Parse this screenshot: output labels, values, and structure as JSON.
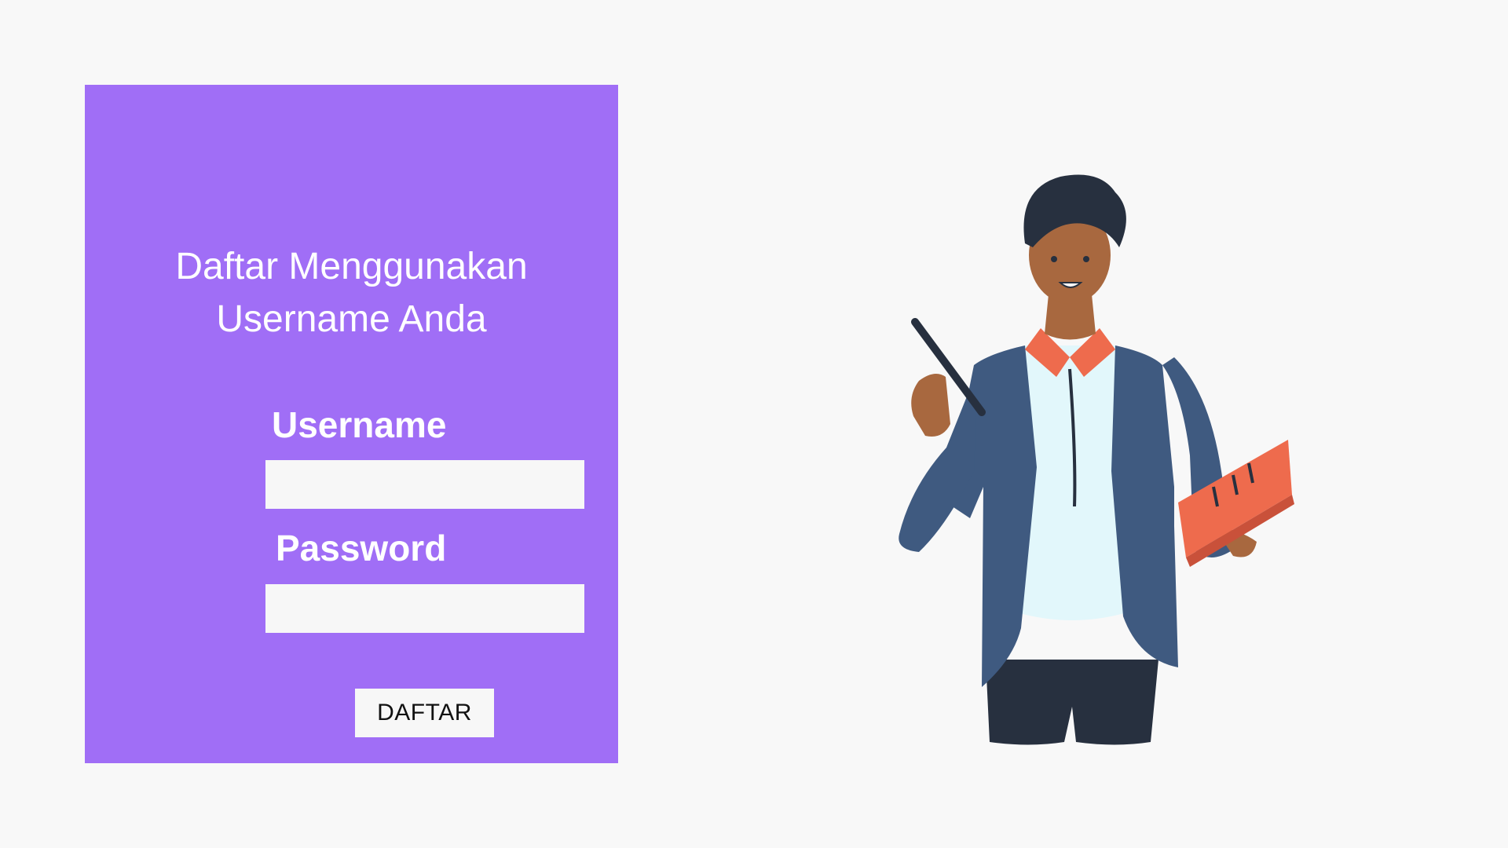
{
  "form": {
    "title_line1": "Daftar Menggunakan",
    "title_line2": "Username Anda",
    "username_label": "Username",
    "username_value": "",
    "password_label": "Password",
    "password_value": "",
    "submit_label": "DAFTAR"
  },
  "illustration": {
    "icon": "person-holding-pen-and-book-icon"
  },
  "colors": {
    "background": "#f8f8f8",
    "card": "#a06ef6",
    "input": "#f7f7f7",
    "jacket": "#3f5a80",
    "shirt": "#e2f7fb",
    "collar": "#ee6b4d",
    "skin": "#a8683f",
    "hair": "#27303f",
    "book": "#ee6b4d"
  }
}
